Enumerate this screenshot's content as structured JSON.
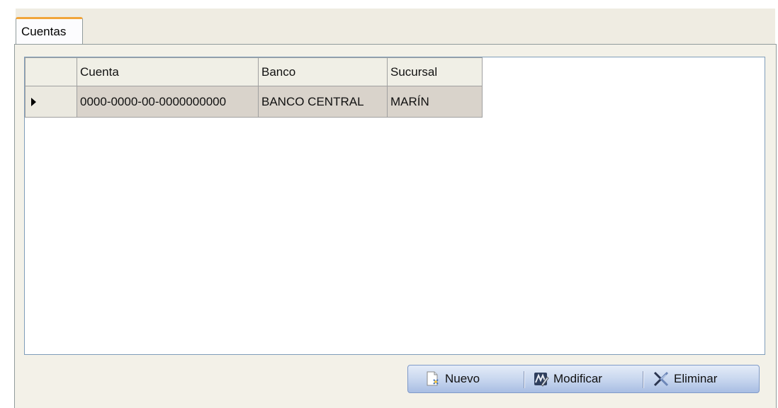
{
  "tabs": [
    {
      "label": "Cuentas"
    }
  ],
  "grid": {
    "columns": [
      "Cuenta",
      "Banco",
      "Sucursal"
    ],
    "rows": [
      {
        "cuenta": "0000-0000-00-0000000000",
        "banco": "BANCO CENTRAL",
        "sucursal": "MARÍN"
      }
    ]
  },
  "toolbar": {
    "nuevo_label": "Nuevo",
    "modificar_label": "Modificar",
    "eliminar_label": "Eliminar"
  },
  "icons": {
    "nuevo": "new-document-icon",
    "modificar": "edit-document-icon",
    "eliminar": "delete-x-icon",
    "row_indicator": "row-pointer-icon"
  },
  "colors": {
    "tab_accent": "#f1a53a",
    "panel_background": "#f3f1e8",
    "selected_row": "#d9d3cb",
    "toolbar_blue": "#c6d5ee"
  }
}
